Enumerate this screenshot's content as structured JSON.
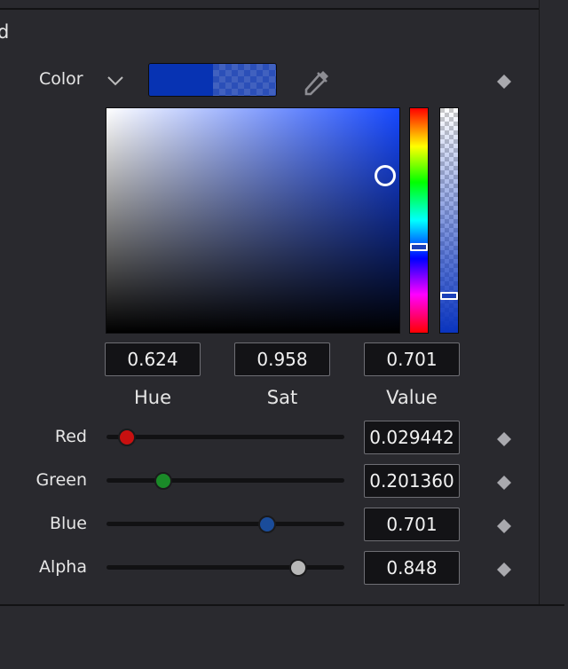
{
  "panel": {
    "title": "d"
  },
  "color": {
    "label": "Color",
    "swatch_color": "#0733b3"
  },
  "picker": {
    "hue": "0.624",
    "sat": "0.958",
    "value": "0.701",
    "hue_label": "Hue",
    "sat_label": "Sat",
    "value_label": "Value",
    "hue_position": 0.624,
    "alpha_position": 0.848
  },
  "channels": {
    "red": {
      "label": "Red",
      "value": "0.029442",
      "slider": 0.029442,
      "knob_color": "#c81010"
    },
    "green": {
      "label": "Green",
      "value": "0.201360",
      "slider": 0.20136,
      "knob_color": "#1a8a28"
    },
    "blue": {
      "label": "Blue",
      "value": "0.701",
      "slider": 0.701,
      "knob_color": "#1a4c9a"
    },
    "alpha": {
      "label": "Alpha",
      "value": "0.848",
      "slider": 0.848,
      "knob_color": "#b8b8b8"
    }
  },
  "icons": {
    "dropdown": "chevron-down-icon",
    "picker": "eyedropper-icon",
    "keyframe": "keyframe-diamond-icon"
  }
}
